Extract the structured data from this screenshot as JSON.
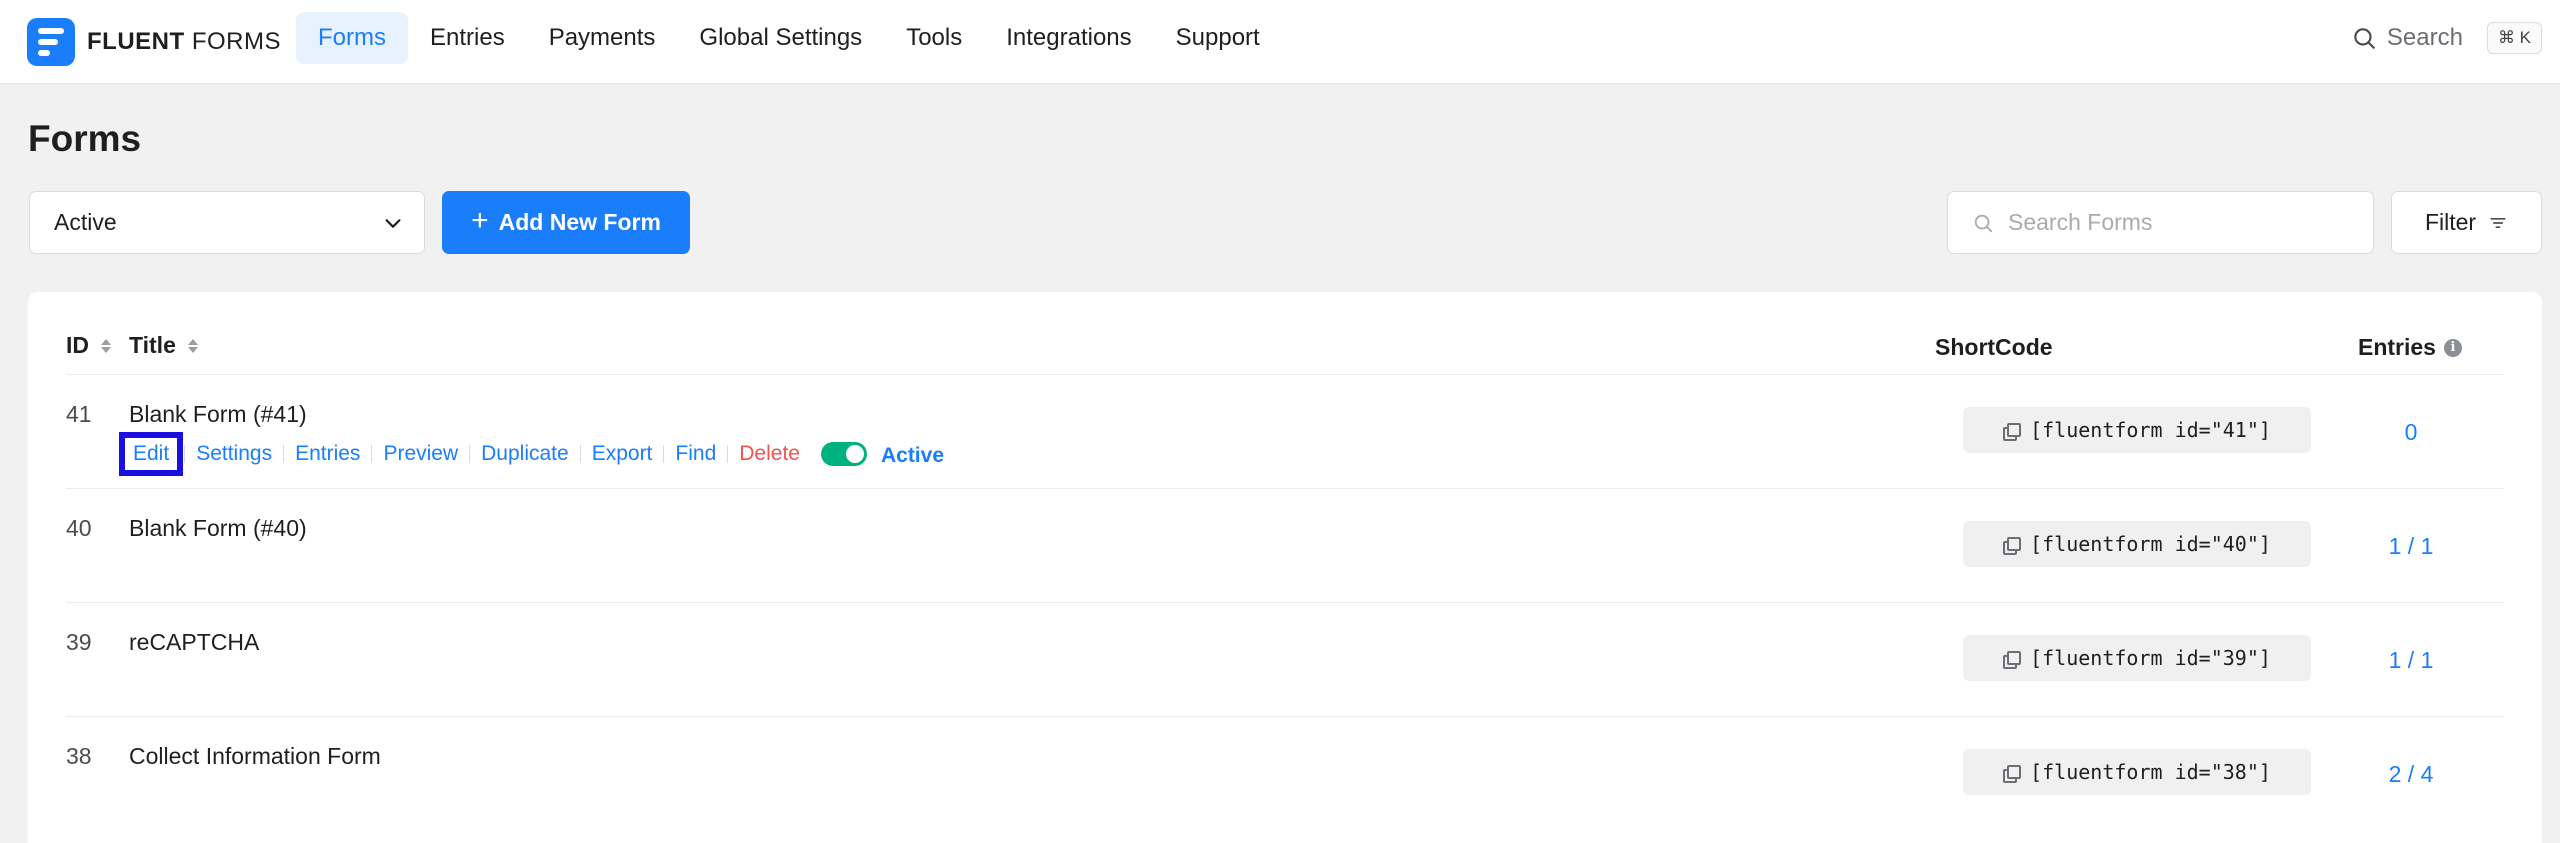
{
  "brand": {
    "name_bold": "FLUENT",
    "name_light": "FORMS",
    "accent_color": "#1a7efb"
  },
  "nav": {
    "items": [
      {
        "label": "Forms",
        "active": true
      },
      {
        "label": "Entries",
        "active": false
      },
      {
        "label": "Payments",
        "active": false
      },
      {
        "label": "Global Settings",
        "active": false
      },
      {
        "label": "Tools",
        "active": false
      },
      {
        "label": "Integrations",
        "active": false
      },
      {
        "label": "Support",
        "active": false
      }
    ],
    "search_label": "Search",
    "search_shortcut": "⌘ K"
  },
  "page": {
    "title": "Forms"
  },
  "toolbar": {
    "status_value": "Active",
    "add_button_label": "Add New Form",
    "search_placeholder": "Search Forms",
    "filter_label": "Filter"
  },
  "table": {
    "headers": {
      "id": "ID",
      "title": "Title",
      "shortcode": "ShortCode",
      "entries": "Entries"
    },
    "row_actions": [
      "Edit",
      "Settings",
      "Entries",
      "Preview",
      "Duplicate",
      "Export",
      "Find",
      "Delete"
    ],
    "status_toggle_label": "Active",
    "rows": [
      {
        "id": "41",
        "title": "Blank Form (#41)",
        "shortcode": "[fluentform id=\"41\"]",
        "entries": "0"
      },
      {
        "id": "40",
        "title": "Blank Form (#40)",
        "shortcode": "[fluentform id=\"40\"]",
        "entries": "1 / 1"
      },
      {
        "id": "39",
        "title": "reCAPTCHA",
        "shortcode": "[fluentform id=\"39\"]",
        "entries": "1 / 1"
      },
      {
        "id": "38",
        "title": "Collect Information Form",
        "shortcode": "[fluentform id=\"38\"]",
        "entries": "2 / 4"
      }
    ]
  },
  "colors": {
    "primary": "#1a7efb",
    "toggle_on": "#00b27f",
    "danger": "#ef5350",
    "highlight_box": "#1a0fe0"
  },
  "icons": [
    "search-icon",
    "chevron-down-icon",
    "plus-icon",
    "filter-icon",
    "sort-icon",
    "info-icon",
    "copy-icon"
  ]
}
